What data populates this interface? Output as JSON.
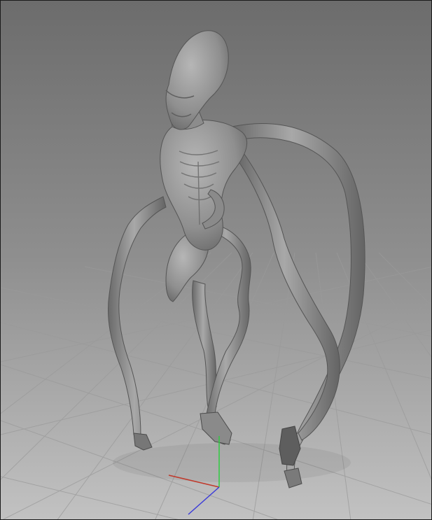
{
  "viewport": {
    "background_top": "#6f6f6f",
    "background_bottom": "#bdbdbd",
    "grid_color": "#8e8e8e",
    "model_color": "#8d8d8d",
    "model_highlight": "#b4b4b4",
    "model_shadow": "#5c5c5c",
    "axis_x_color": "#c0392b",
    "axis_y_color": "#2ecc40",
    "axis_z_color": "#3b3bd9",
    "subject": "sculpted-creature-model",
    "gizmo": "world-axis-gizmo"
  }
}
